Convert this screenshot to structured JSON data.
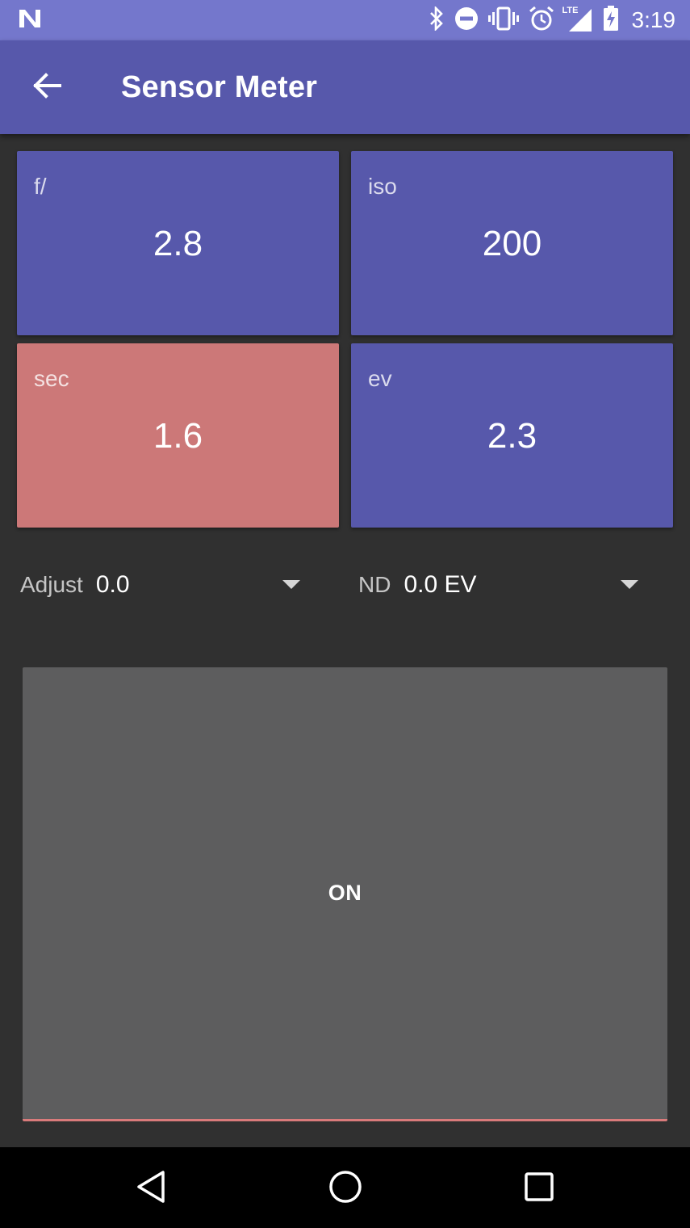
{
  "status_bar": {
    "time": "3:19",
    "icons": [
      "notification-n-icon",
      "bluetooth-icon",
      "do-not-disturb-icon",
      "vibrate-icon",
      "alarm-icon",
      "lte-signal-icon",
      "battery-charging-icon"
    ],
    "lte_label": "LTE"
  },
  "app_bar": {
    "title": "Sensor Meter",
    "back_icon": "arrow-back-icon"
  },
  "tiles": [
    {
      "label": "f/",
      "value": "2.8",
      "color": "#5758ab"
    },
    {
      "label": "iso",
      "value": "200",
      "color": "#5758ab"
    },
    {
      "label": "sec",
      "value": "1.6",
      "color": "#cc7878"
    },
    {
      "label": "ev",
      "value": "2.3",
      "color": "#5758ab"
    }
  ],
  "adjust": {
    "label": "Adjust",
    "value": "0.0"
  },
  "nd": {
    "label": "ND",
    "value": "0.0 EV"
  },
  "on_button": {
    "label": "ON",
    "underline_color": "#d97b7b"
  },
  "nav_bar": {
    "icons": [
      "back-triangle-icon",
      "home-circle-icon",
      "recents-square-icon"
    ]
  },
  "colors": {
    "status_bar": "#7477cc",
    "app_bar": "#5758ab",
    "background": "#303030"
  }
}
